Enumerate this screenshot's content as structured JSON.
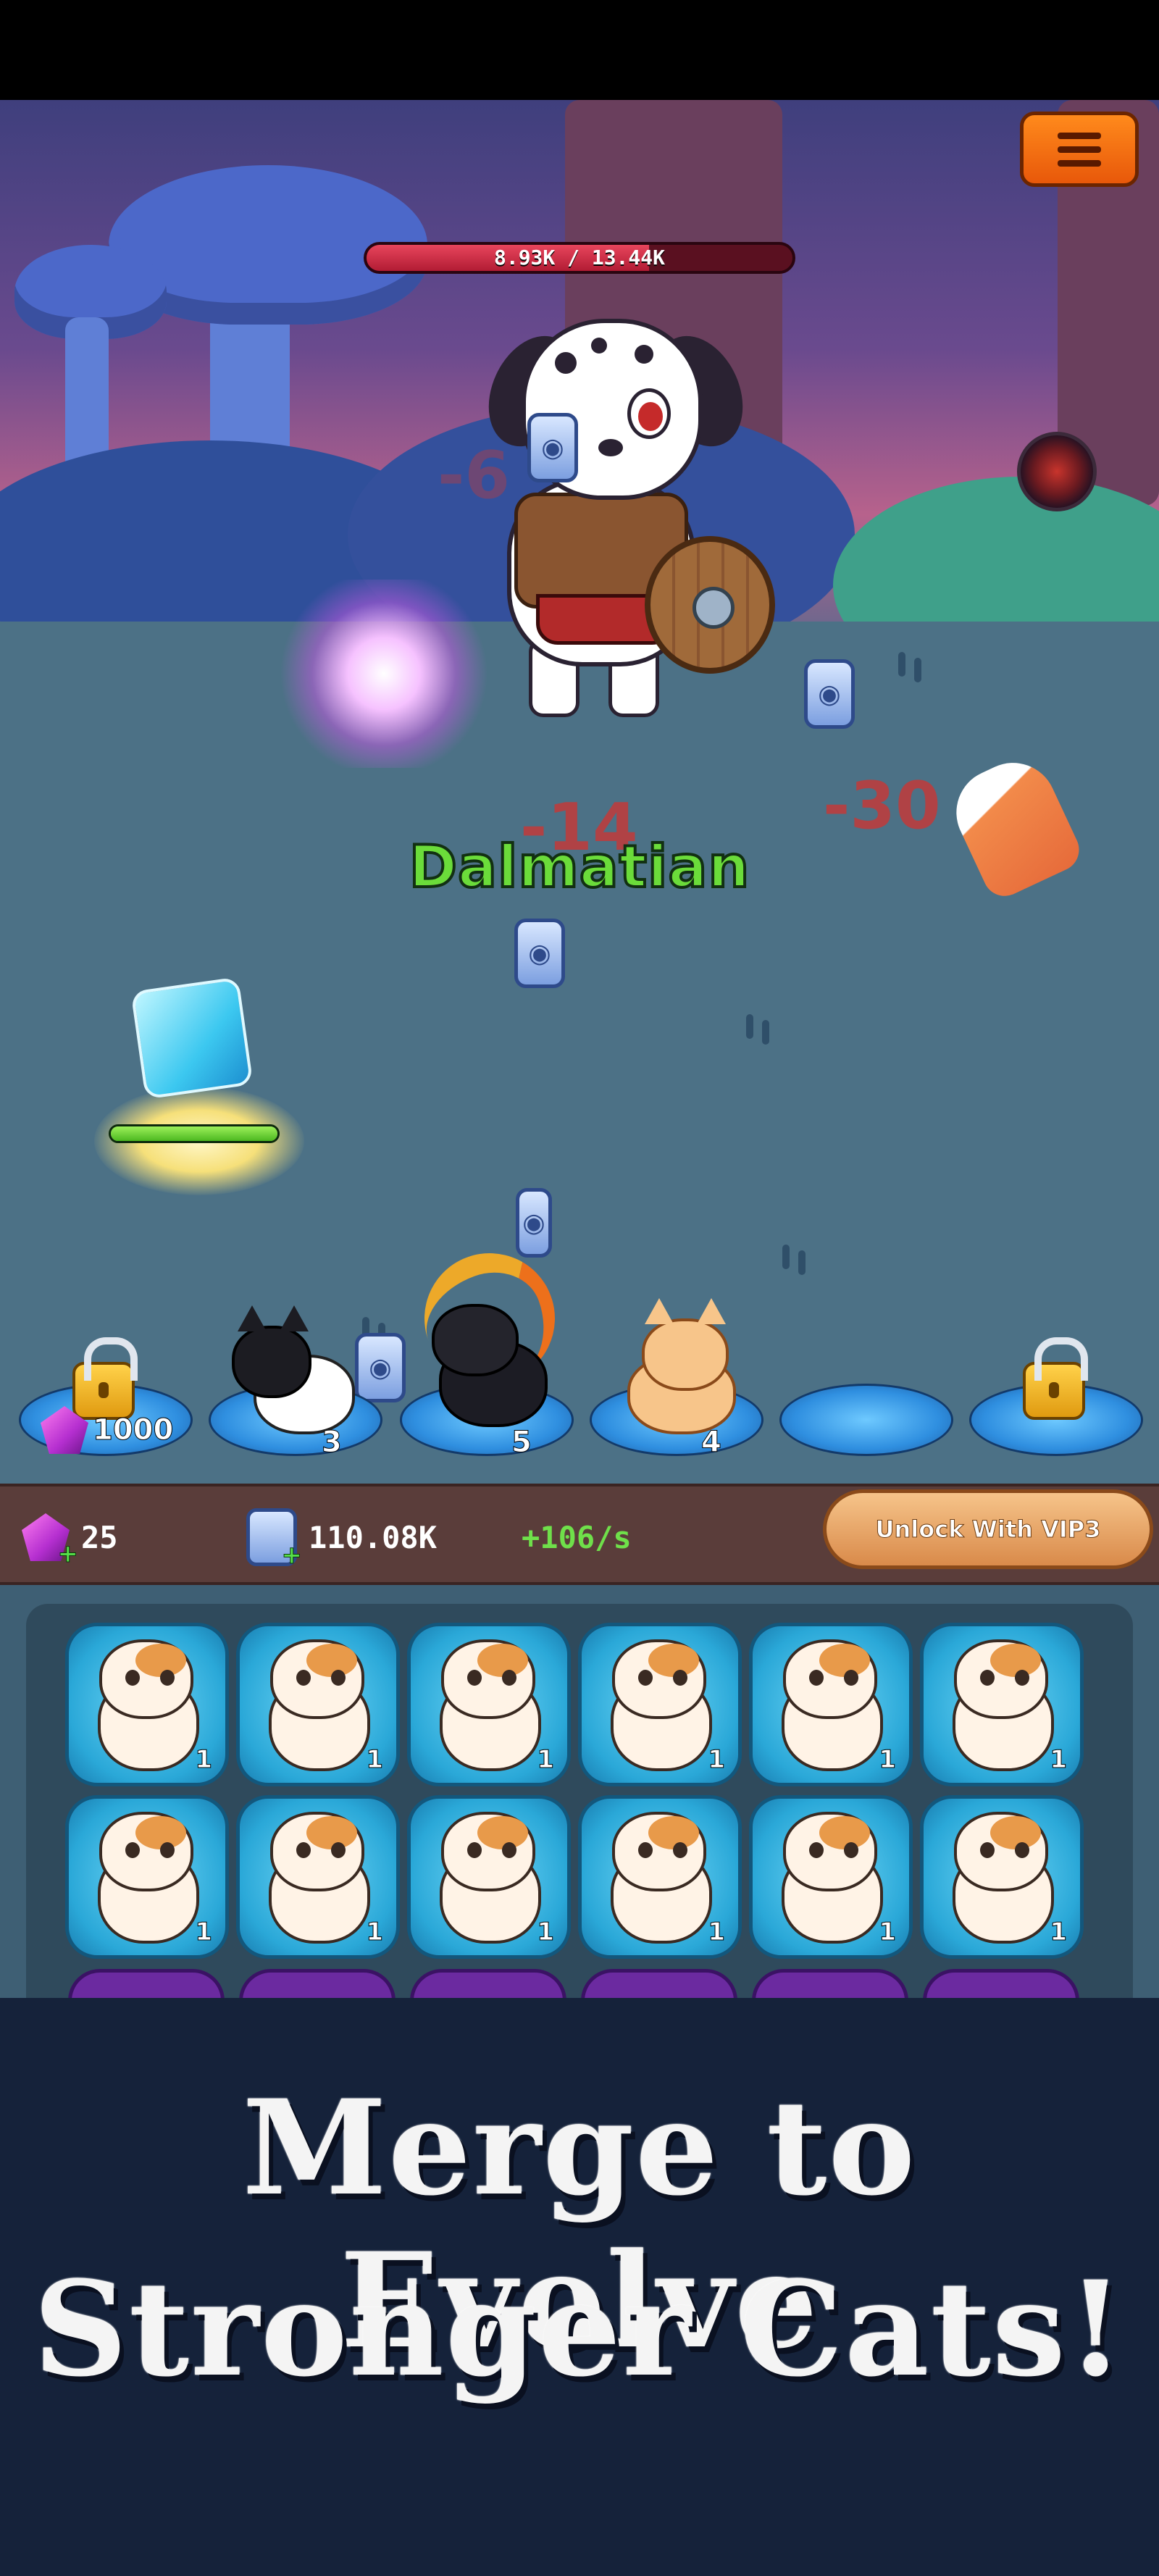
{
  "hud": {
    "menu_icon": "hamburger-icon",
    "boss_hp_text": "8.93K / 13.44K",
    "boss_hp_fraction": 0.664,
    "skill_icon": "fire-skill-icon"
  },
  "boss": {
    "name": "Dalmatian"
  },
  "damage_numbers": [
    "-6",
    "-14",
    "-30"
  ],
  "slots": {
    "unlock_cost": "1000",
    "levels": [
      "3",
      "5",
      "4"
    ]
  },
  "resources": {
    "gems": "25",
    "coins": "110.08K",
    "income": "+106/s",
    "vip_button": "Unlock With VIP3"
  },
  "merge_grid": {
    "tile_levels": [
      "1",
      "1",
      "1",
      "1",
      "1",
      "1",
      "1",
      "1",
      "1",
      "1",
      "1",
      "1"
    ]
  },
  "promo": {
    "line1": "Merge to Evolve",
    "line2": "Stronger Cats!"
  },
  "colors": {
    "boss_name": "#6bdc3a",
    "hp_bar": "#e8455c",
    "income": "#6fe04a",
    "promo_bg": "#15223a"
  }
}
